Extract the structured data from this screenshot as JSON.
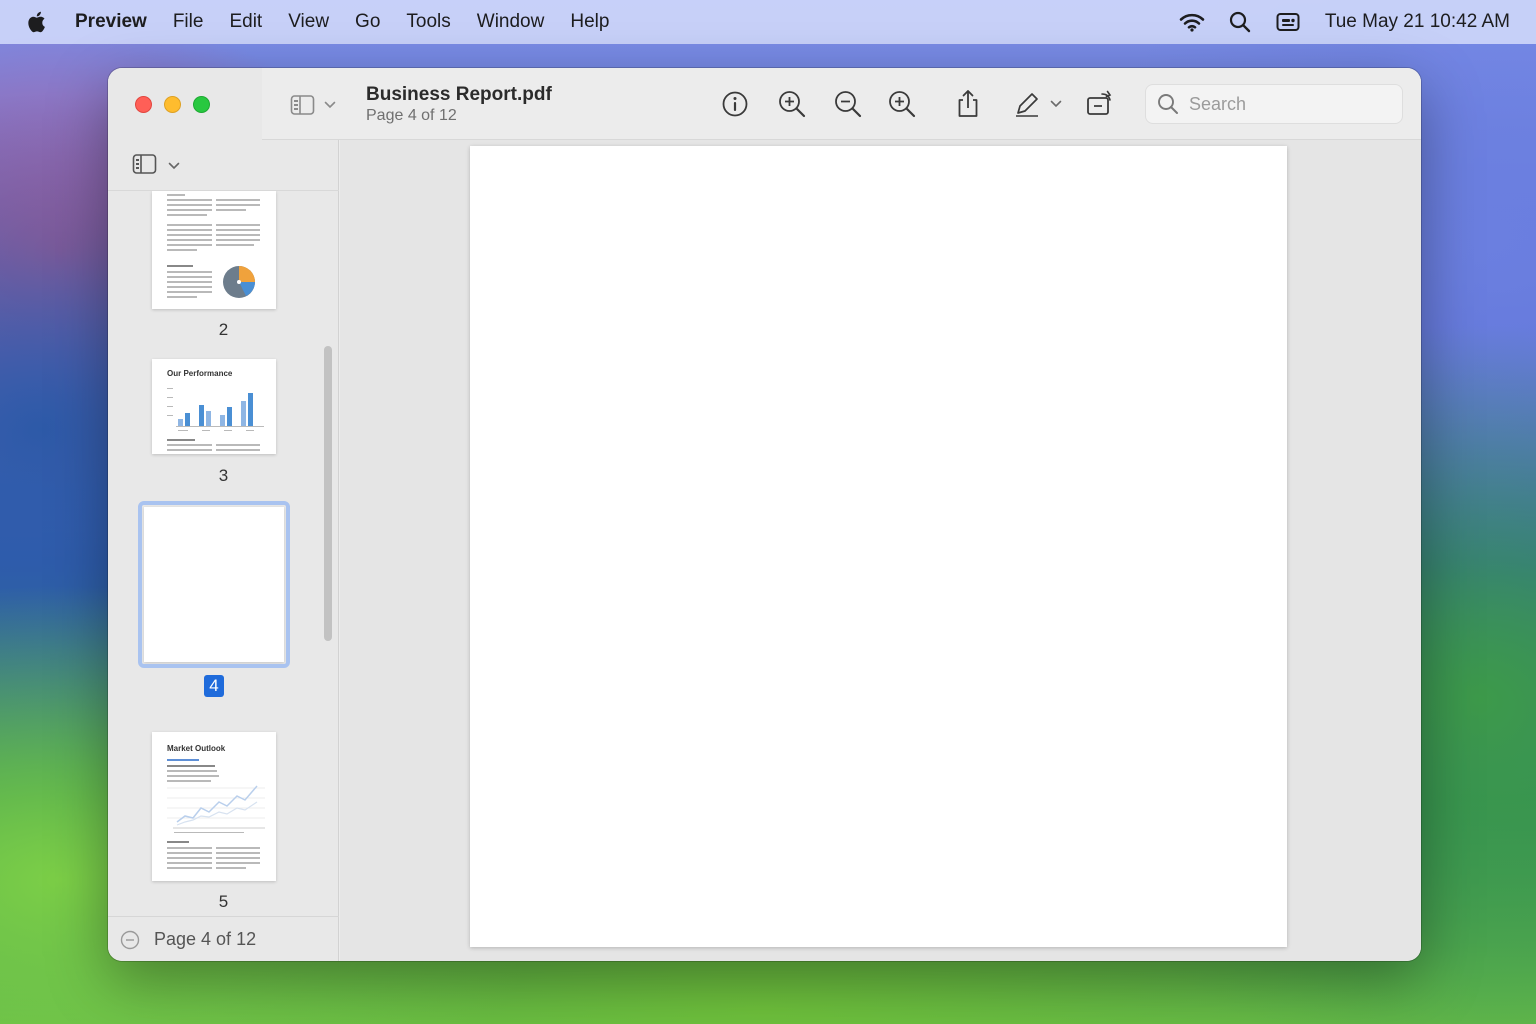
{
  "menubar": {
    "app_name": "Preview",
    "menus": [
      "File",
      "Edit",
      "View",
      "Go",
      "Tools",
      "Window",
      "Help"
    ],
    "clock": "Tue May 21  10:42 AM"
  },
  "window": {
    "title": "Business Report.pdf",
    "subtitle": "Page 4 of 12",
    "search_placeholder": "Search"
  },
  "sidebar": {
    "thumbnails": [
      {
        "label": "2",
        "heading": ""
      },
      {
        "label": "3",
        "heading": "Our Performance"
      },
      {
        "label": "4",
        "heading": "",
        "selected": true
      },
      {
        "label": "5",
        "heading": "Market Outlook"
      }
    ],
    "footer_status": "Page 4 of 12"
  },
  "colors": {
    "selection_accent": "#1f6bdb",
    "chart_blue": "#4a8fd4",
    "chart_orange": "#f0a23c"
  }
}
